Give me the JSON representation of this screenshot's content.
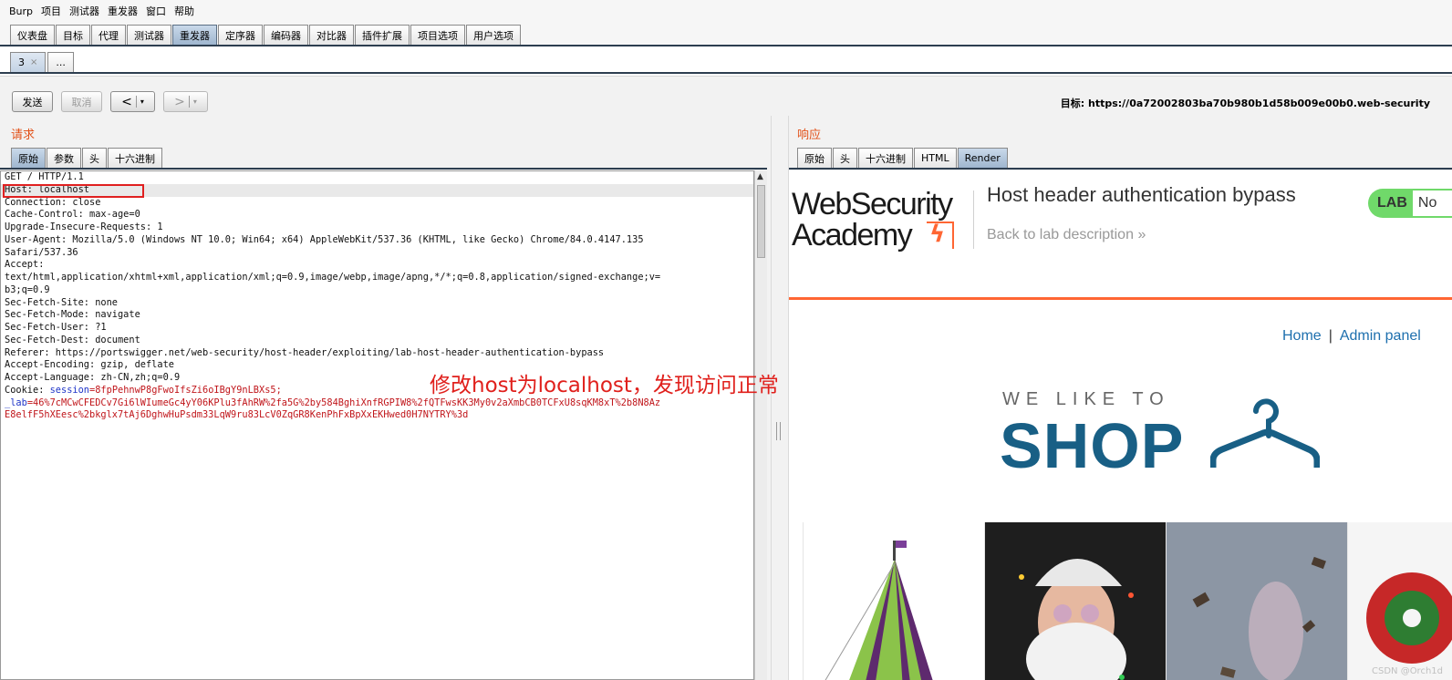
{
  "menubar": [
    "Burp",
    "项目",
    "测试器",
    "重发器",
    "窗口",
    "帮助"
  ],
  "main_tabs": [
    "仪表盘",
    "目标",
    "代理",
    "测试器",
    "重发器",
    "定序器",
    "编码器",
    "对比器",
    "插件扩展",
    "项目选项",
    "用户选项"
  ],
  "main_tabs_active": "重发器",
  "sub_tabs": {
    "current": "3",
    "close": "×",
    "more": "..."
  },
  "toolbar": {
    "send": "发送",
    "cancel": "取消",
    "back": "<",
    "forward": ">",
    "dropdown": "▾",
    "target_label": "目标:",
    "target_url": "https://0a72002803ba70b980b1d58b009e00b0.web-security"
  },
  "request": {
    "title": "请求",
    "tabs": [
      "原始",
      "参数",
      "头",
      "十六进制"
    ],
    "lines": [
      "GET / HTTP/1.1",
      "Host: localhost",
      "Connection: close",
      "Cache-Control: max-age=0",
      "Upgrade-Insecure-Requests: 1",
      "User-Agent: Mozilla/5.0 (Windows NT 10.0; Win64; x64) AppleWebKit/537.36 (KHTML, like Gecko) Chrome/84.0.4147.135",
      "Safari/537.36",
      "Accept:",
      "text/html,application/xhtml+xml,application/xml;q=0.9,image/webp,image/apng,*/*;q=0.8,application/signed-exchange;v=",
      "b3;q=0.9",
      "Sec-Fetch-Site: none",
      "Sec-Fetch-Mode: navigate",
      "Sec-Fetch-User: ?1",
      "Sec-Fetch-Dest: document",
      "Referer: https://portswigger.net/web-security/host-header/exploiting/lab-host-header-authentication-bypass",
      "Accept-Encoding: gzip, deflate",
      "Accept-Language: zh-CN,zh;q=0.9"
    ],
    "cookie": {
      "label": "Cookie: ",
      "session_key": "session",
      "session_value": "=8fpPehnwP8gFwoIfsZi6oIBgY9nLBXs5;",
      "lab_key": "_lab",
      "lab_value_1": "=46%7cMCwCFEDCv7Gi6lWIumeGc4yY06KPlu3fAhRW%2fa5G%2by584BghiXnfRGPIW8%2fQTFwsKK3My0v2aXmbCB0TCFxU8sqKM8xT%2b8N8Az",
      "lab_value_2": "E8elfF5hXEesc%2bkglx7tAj6DghwHuPsdm33LqW9ru83LcV0ZqGR8KenPhFxBpXxEKHwed0H7NYTRY%3d"
    },
    "annotation": "修改host为localhost，发现访问正常"
  },
  "response": {
    "title": "响应",
    "tabs": [
      "原始",
      "头",
      "十六进制",
      "HTML",
      "Render"
    ],
    "active_tab": "Render",
    "page": {
      "logo_line1": "WebSecurity",
      "logo_line2": "Academy",
      "lab_title": "Host header authentication bypass",
      "back_link": "Back to lab description",
      "back_chevron": "»",
      "badge_label": "LAB",
      "badge_status": "No",
      "nav_home": "Home",
      "nav_sep": "|",
      "nav_admin": "Admin panel",
      "tagline": "WE LIKE TO",
      "shop": "SHOP"
    }
  },
  "watermark": "CSDN @Orch1d",
  "colors": {
    "accent_orange": "#ff6633",
    "shop_blue": "#185f85",
    "link_blue": "#1d6fae",
    "lab_green": "#70d96a",
    "annotation_red": "#e0201c"
  }
}
